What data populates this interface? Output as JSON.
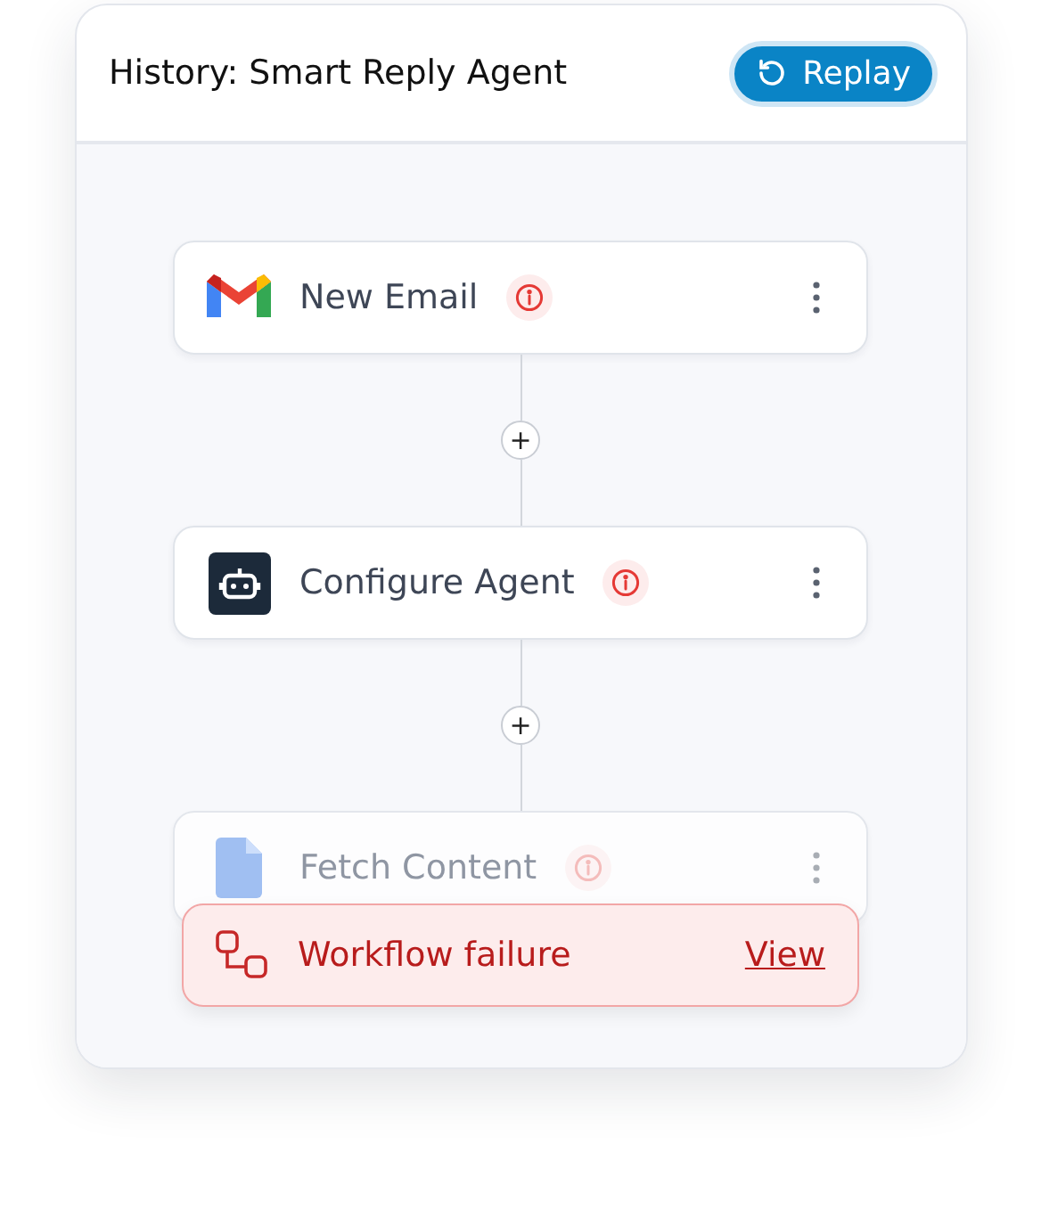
{
  "header": {
    "title": "History: Smart Reply Agent",
    "button": "Replay"
  },
  "nodes": [
    {
      "kind": "gmail",
      "label": "New Email",
      "warning": true,
      "blurred": false
    },
    {
      "kind": "agent",
      "label": "Configure Agent",
      "warning": true,
      "blurred": false
    },
    {
      "kind": "doc",
      "label": "Fetch Content",
      "warning": true,
      "blurred": true
    }
  ],
  "connector_button": "+",
  "toast": {
    "message": "Workflow failure",
    "link": "View"
  }
}
